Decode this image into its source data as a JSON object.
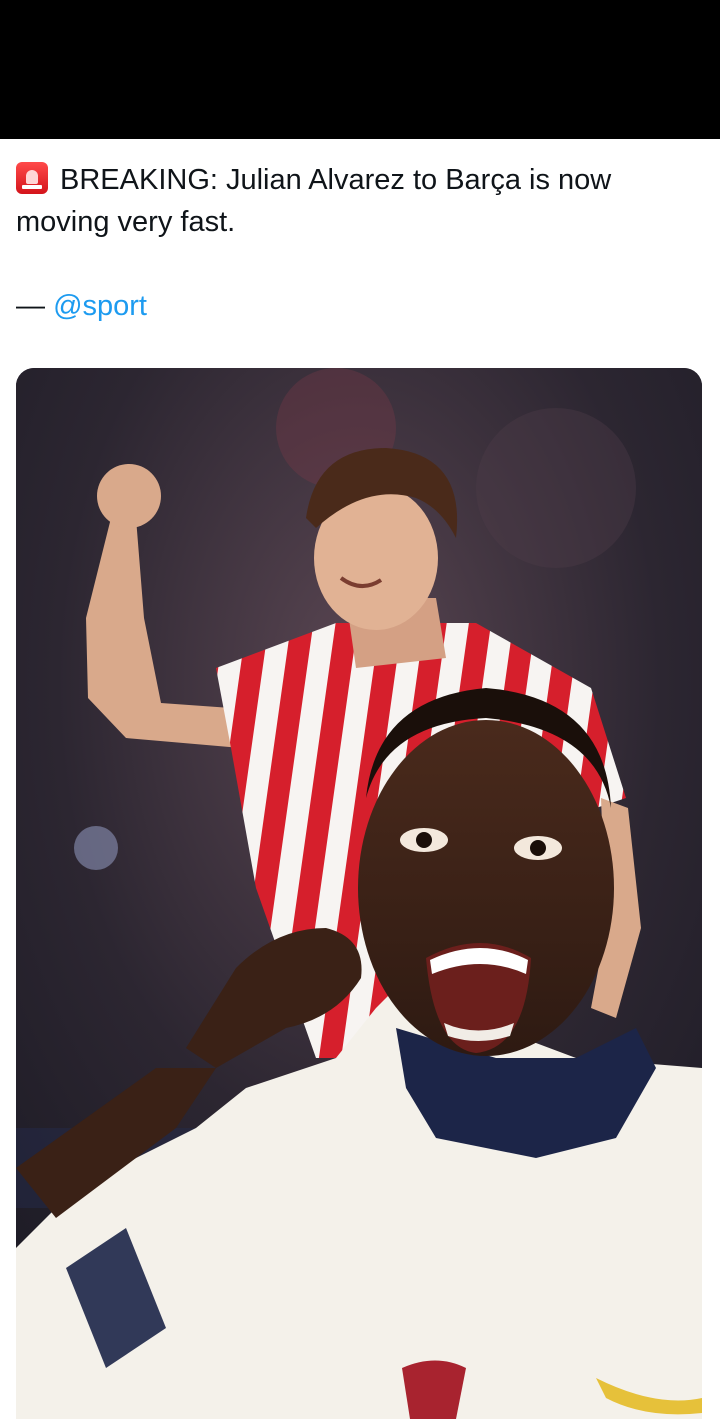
{
  "tweet": {
    "text": "BREAKING: Julian Alvarez to Barça is now moving very fast.",
    "credit_dash": "— ",
    "mention": "@sport",
    "icons": {
      "alert": "rotating-light-icon"
    }
  },
  "colors": {
    "top_bar": "#000000",
    "background": "#ffffff",
    "text": "#0f1419",
    "link": "#1d9bf0",
    "jersey_red": "#d61f2c",
    "jersey_white": "#f7f4f2",
    "reactor_shirt": "#f4f1ea",
    "reactor_collar": "#1c2548"
  }
}
